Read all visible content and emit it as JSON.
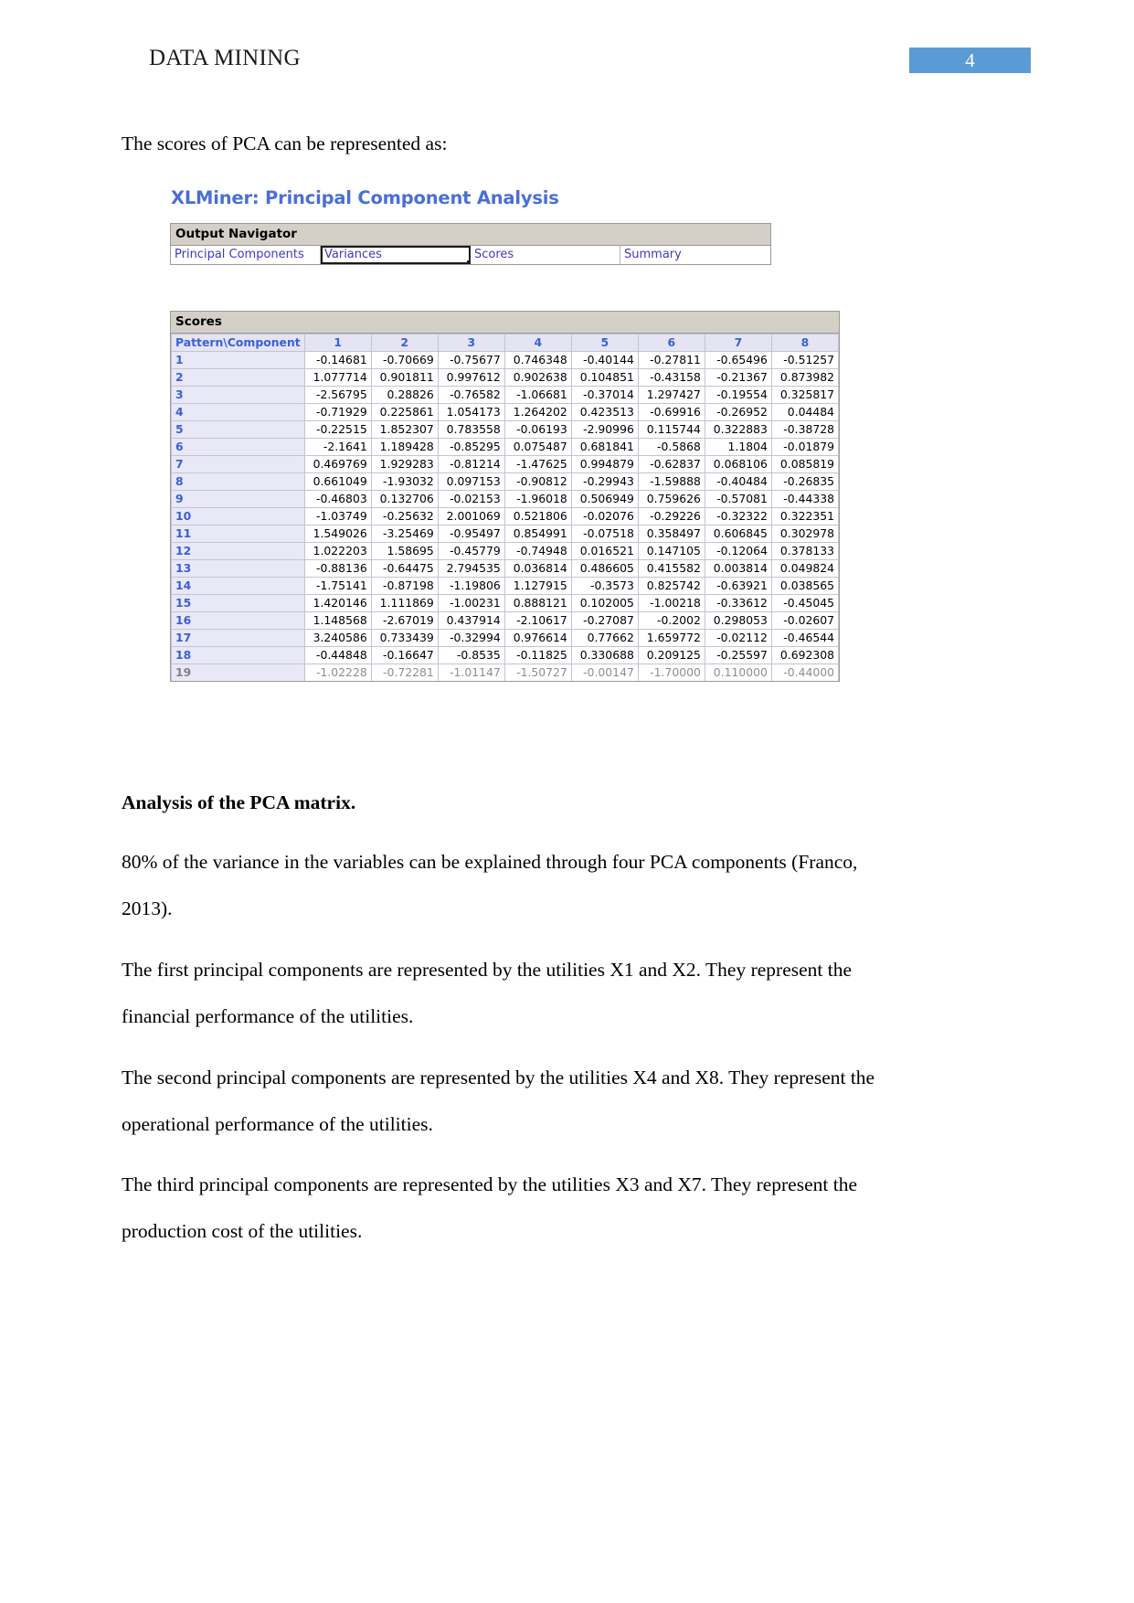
{
  "header": {
    "title": "DATA MINING",
    "page_number": "4",
    "badge_color": "#5b9bd5"
  },
  "intro_paragraph": "The scores of PCA can be represented as:",
  "xlminer": {
    "title": "XLMiner: Principal Component Analysis",
    "navigator": {
      "header": "Output Navigator",
      "links": [
        {
          "label": "Principal Components",
          "selected": false
        },
        {
          "label": "Variances",
          "selected": true
        },
        {
          "label": "Scores",
          "selected": false
        },
        {
          "label": "Summary",
          "selected": false
        }
      ]
    },
    "scores": {
      "header": "Scores",
      "corner_label": "Pattern\\Component",
      "columns": [
        "1",
        "2",
        "3",
        "4",
        "5",
        "6",
        "7",
        "8"
      ],
      "rows": [
        {
          "label": "1",
          "values": [
            "-0.14681",
            "-0.70669",
            "-0.75677",
            "0.746348",
            "-0.40144",
            "-0.27811",
            "-0.65496",
            "-0.51257"
          ]
        },
        {
          "label": "2",
          "values": [
            "1.077714",
            "0.901811",
            "0.997612",
            "0.902638",
            "0.104851",
            "-0.43158",
            "-0.21367",
            "0.873982"
          ]
        },
        {
          "label": "3",
          "values": [
            "-2.56795",
            "0.28826",
            "-0.76582",
            "-1.06681",
            "-0.37014",
            "1.297427",
            "-0.19554",
            "0.325817"
          ]
        },
        {
          "label": "4",
          "values": [
            "-0.71929",
            "0.225861",
            "1.054173",
            "1.264202",
            "0.423513",
            "-0.69916",
            "-0.26952",
            "0.04484"
          ]
        },
        {
          "label": "5",
          "values": [
            "-0.22515",
            "1.852307",
            "0.783558",
            "-0.06193",
            "-2.90996",
            "0.115744",
            "0.322883",
            "-0.38728"
          ]
        },
        {
          "label": "6",
          "values": [
            "-2.1641",
            "1.189428",
            "-0.85295",
            "0.075487",
            "0.681841",
            "-0.5868",
            "1.1804",
            "-0.01879"
          ]
        },
        {
          "label": "7",
          "values": [
            "0.469769",
            "1.929283",
            "-0.81214",
            "-1.47625",
            "0.994879",
            "-0.62837",
            "0.068106",
            "0.085819"
          ]
        },
        {
          "label": "8",
          "values": [
            "0.661049",
            "-1.93032",
            "0.097153",
            "-0.90812",
            "-0.29943",
            "-1.59888",
            "-0.40484",
            "-0.26835"
          ]
        },
        {
          "label": "9",
          "values": [
            "-0.46803",
            "0.132706",
            "-0.02153",
            "-1.96018",
            "0.506949",
            "0.759626",
            "-0.57081",
            "-0.44338"
          ]
        },
        {
          "label": "10",
          "values": [
            "-1.03749",
            "-0.25632",
            "2.001069",
            "0.521806",
            "-0.02076",
            "-0.29226",
            "-0.32322",
            "0.322351"
          ]
        },
        {
          "label": "11",
          "values": [
            "1.549026",
            "-3.25469",
            "-0.95497",
            "0.854991",
            "-0.07518",
            "0.358497",
            "0.606845",
            "0.302978"
          ]
        },
        {
          "label": "12",
          "values": [
            "1.022203",
            "1.58695",
            "-0.45779",
            "-0.74948",
            "0.016521",
            "0.147105",
            "-0.12064",
            "0.378133"
          ]
        },
        {
          "label": "13",
          "values": [
            "-0.88136",
            "-0.64475",
            "2.794535",
            "0.036814",
            "0.486605",
            "0.415582",
            "0.003814",
            "0.049824"
          ]
        },
        {
          "label": "14",
          "values": [
            "-1.75141",
            "-0.87198",
            "-1.19806",
            "1.127915",
            "-0.3573",
            "0.825742",
            "-0.63921",
            "0.038565"
          ]
        },
        {
          "label": "15",
          "values": [
            "1.420146",
            "1.111869",
            "-1.00231",
            "0.888121",
            "0.102005",
            "-1.00218",
            "-0.33612",
            "-0.45045"
          ]
        },
        {
          "label": "16",
          "values": [
            "1.148568",
            "-2.67019",
            "0.437914",
            "-2.10617",
            "-0.27087",
            "-0.2002",
            "0.298053",
            "-0.02607"
          ]
        },
        {
          "label": "17",
          "values": [
            "3.240586",
            "0.733439",
            "-0.32994",
            "0.976614",
            "0.77662",
            "1.659772",
            "-0.02112",
            "-0.46544"
          ]
        },
        {
          "label": "18",
          "values": [
            "-0.44848",
            "-0.16647",
            "-0.8535",
            "-0.11825",
            "0.330688",
            "0.209125",
            "-0.25597",
            "0.692308"
          ]
        },
        {
          "label": "19",
          "values": [
            "-1.02228",
            "-0.72281",
            "-1.01147",
            "-1.50727",
            "-0.00147",
            "-1.70000",
            "0.110000",
            "-0.44000"
          ]
        }
      ]
    }
  },
  "analysis": {
    "heading": "Analysis of the PCA matrix.",
    "paragraphs": [
      "80% of the variance in the variables can be explained through four PCA components (Franco, 2013).",
      "The first principal components are represented by the utilities X1 and X2. They represent the financial performance of the utilities.",
      "The second principal components are represented by the utilities X4 and X8. They represent the operational performance of the utilities.",
      "The third principal components are represented by the utilities X3 and X7. They represent the production cost of the utilities."
    ]
  }
}
